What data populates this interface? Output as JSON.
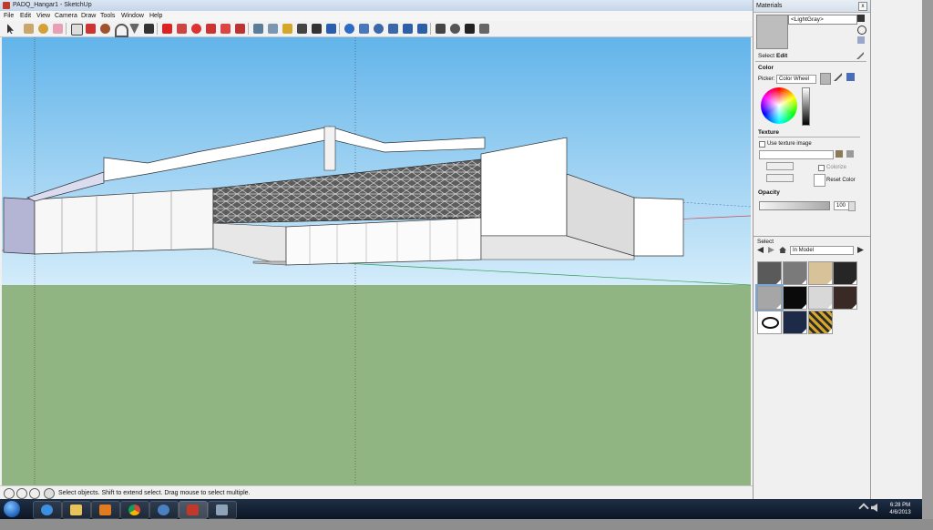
{
  "window": {
    "title": "PADQ_Hangar1 - SketchUp"
  },
  "menu": [
    "File",
    "Edit",
    "View",
    "Camera",
    "Draw",
    "Tools",
    "Window",
    "Help"
  ],
  "status": {
    "message": "Select objects. Shift to extend select. Drag mouse to select multiple."
  },
  "colors": {
    "sky_top": "#62b4ea",
    "sky_bottom": "#d3ecfa",
    "ground": "#91b483",
    "building": "#ffffff"
  },
  "materials": {
    "title": "Materials",
    "close": "x",
    "current_material": "<LightGray>",
    "tabs": [
      "Select",
      "Edit"
    ],
    "active_tab": "Edit",
    "color_section": "Color",
    "picker_label": "Picker:",
    "picker_value": "Color Wheel",
    "texture_section": "Texture",
    "use_texture_label": "Use texture image",
    "colorize_label": "Colorize",
    "reset_color_label": "Reset Color",
    "opacity_section": "Opacity",
    "opacity_value": "100",
    "select_section": "Select",
    "collection": "In Model",
    "swatches": [
      "#5a5a5a",
      "#7a7a7a",
      "#d8c29a",
      "#262626",
      "#a6a6a6",
      "#0a0a0a",
      "#d8d8d8",
      "#3a2a25",
      "#ffffff",
      "#1d2b48",
      "#d4a72a"
    ]
  },
  "taskbar": {
    "time": "6:28 PM",
    "date": "4/6/2013"
  }
}
